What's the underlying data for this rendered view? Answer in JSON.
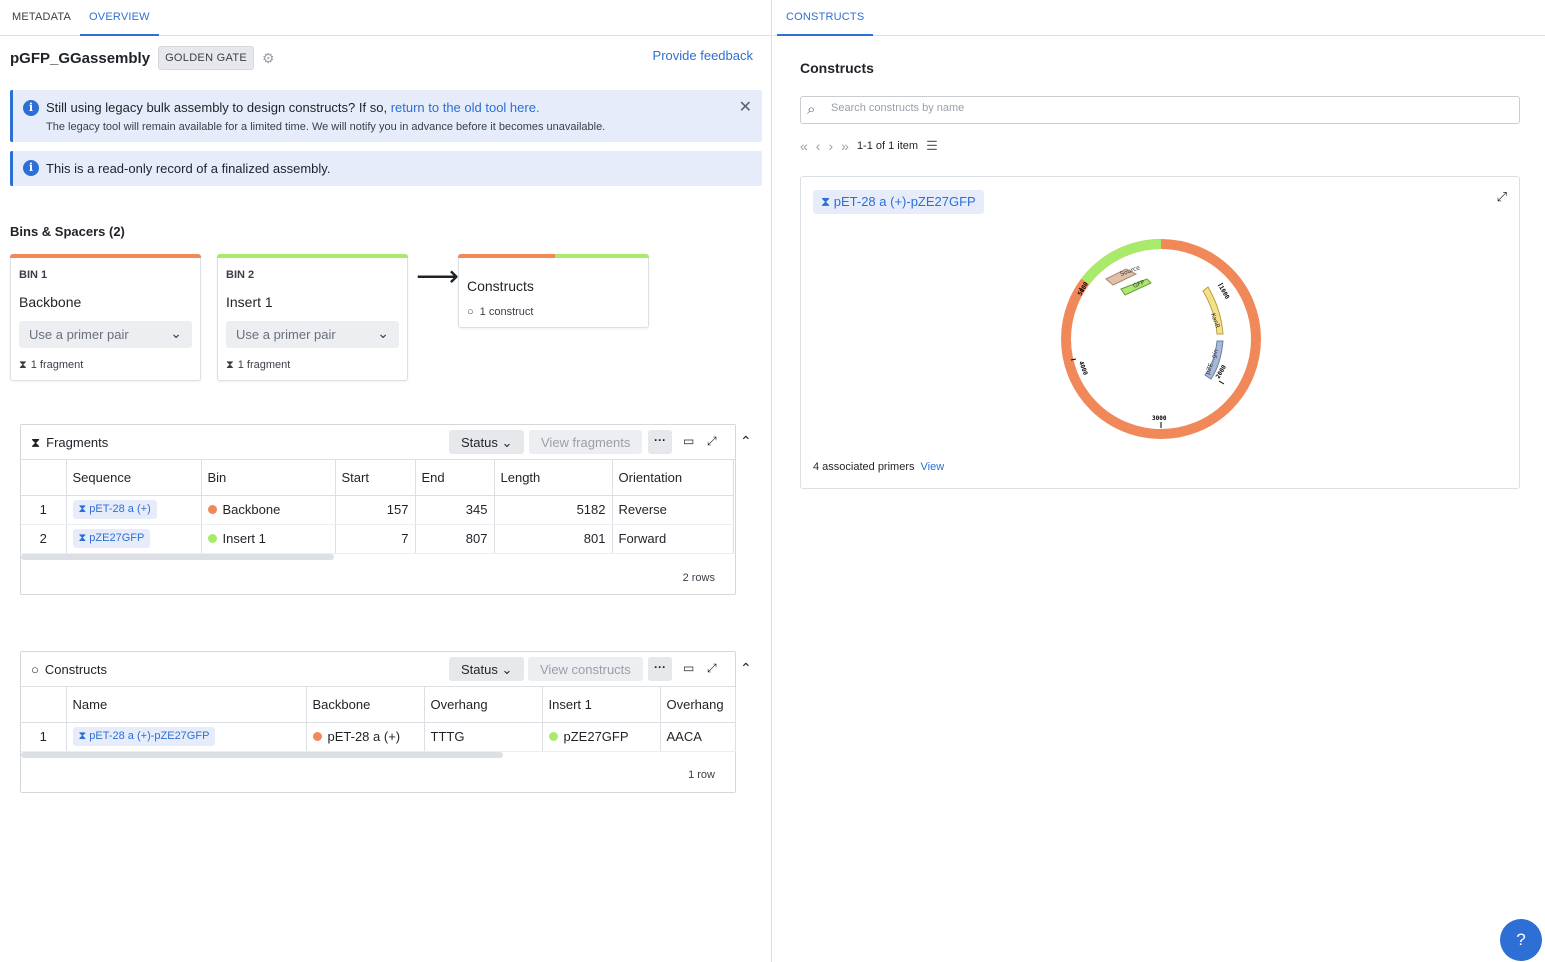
{
  "left_tabs": [
    "METADATA",
    "OVERVIEW"
  ],
  "right_tabs": [
    "CONSTRUCTS"
  ],
  "header": {
    "title": "pGFP_GGassembly",
    "type_badge": "GOLDEN GATE",
    "feedback": "Provide feedback"
  },
  "callouts": {
    "legacy_text": "Still using legacy bulk assembly to design constructs? If so,",
    "legacy_link": "return to the old tool here.",
    "legacy_sub": "The legacy tool will remain available for a limited time. We will notify you in advance before it becomes unavailable.",
    "readonly": "This is a read-only record of a finalized assembly."
  },
  "bins_section": {
    "title": "Bins & Spacers (2)",
    "bins": [
      {
        "label": "BIN 1",
        "name": "Backbone",
        "select": "Use a primer pair",
        "fragments": "1 fragment",
        "color": "#f0885a"
      },
      {
        "label": "BIN 2",
        "name": "Insert 1",
        "select": "Use a primer pair",
        "fragments": "1 fragment",
        "color": "#a8ea6a"
      }
    ],
    "constructs_card": {
      "title": "Constructs",
      "count": "1 construct"
    }
  },
  "fragments_panel": {
    "title": "Fragments",
    "status": "Status",
    "view": "View fragments",
    "columns": [
      "Sequence",
      "Bin",
      "Start",
      "End",
      "Length",
      "Orientation"
    ],
    "rows": [
      {
        "idx": "1",
        "sequence": "pET-28 a (+)",
        "bin": "Backbone",
        "bin_color": "#f0885a",
        "start": "157",
        "end": "345",
        "length": "5182",
        "orientation": "Reverse"
      },
      {
        "idx": "2",
        "sequence": "pZE27GFP",
        "bin": "Insert 1",
        "bin_color": "#a8ea6a",
        "start": "7",
        "end": "807",
        "length": "801",
        "orientation": "Forward"
      }
    ],
    "footer": "2 rows"
  },
  "constructs_panel": {
    "title": "Constructs",
    "status": "Status",
    "view": "View constructs",
    "columns": [
      "Name",
      "Backbone",
      "Overhang",
      "Insert 1",
      "Overhang"
    ],
    "rows": [
      {
        "idx": "1",
        "name": "pET-28 a (+)-pZE27GFP",
        "backbone": "pET-28 a (+)",
        "backbone_color": "#f0885a",
        "overhang1": "TTTG",
        "insert": "pZE27GFP",
        "insert_color": "#a8ea6a",
        "overhang2": "AACA"
      }
    ],
    "footer": "1 row"
  },
  "right": {
    "title": "Constructs",
    "search_placeholder": "Search constructs by name",
    "pager_text": "1-1 of 1 item",
    "construct": {
      "name": "pET-28 a (+)-pZE27GFP",
      "primers_text": "4 associated primers",
      "primers_link": "View",
      "map_ticks": [
        "1000",
        "2000",
        "3000",
        "4000",
        "5000"
      ],
      "map_features": [
        "Source",
        "GFP",
        "KanR",
        "pZE...gin"
      ]
    }
  },
  "help": "?"
}
